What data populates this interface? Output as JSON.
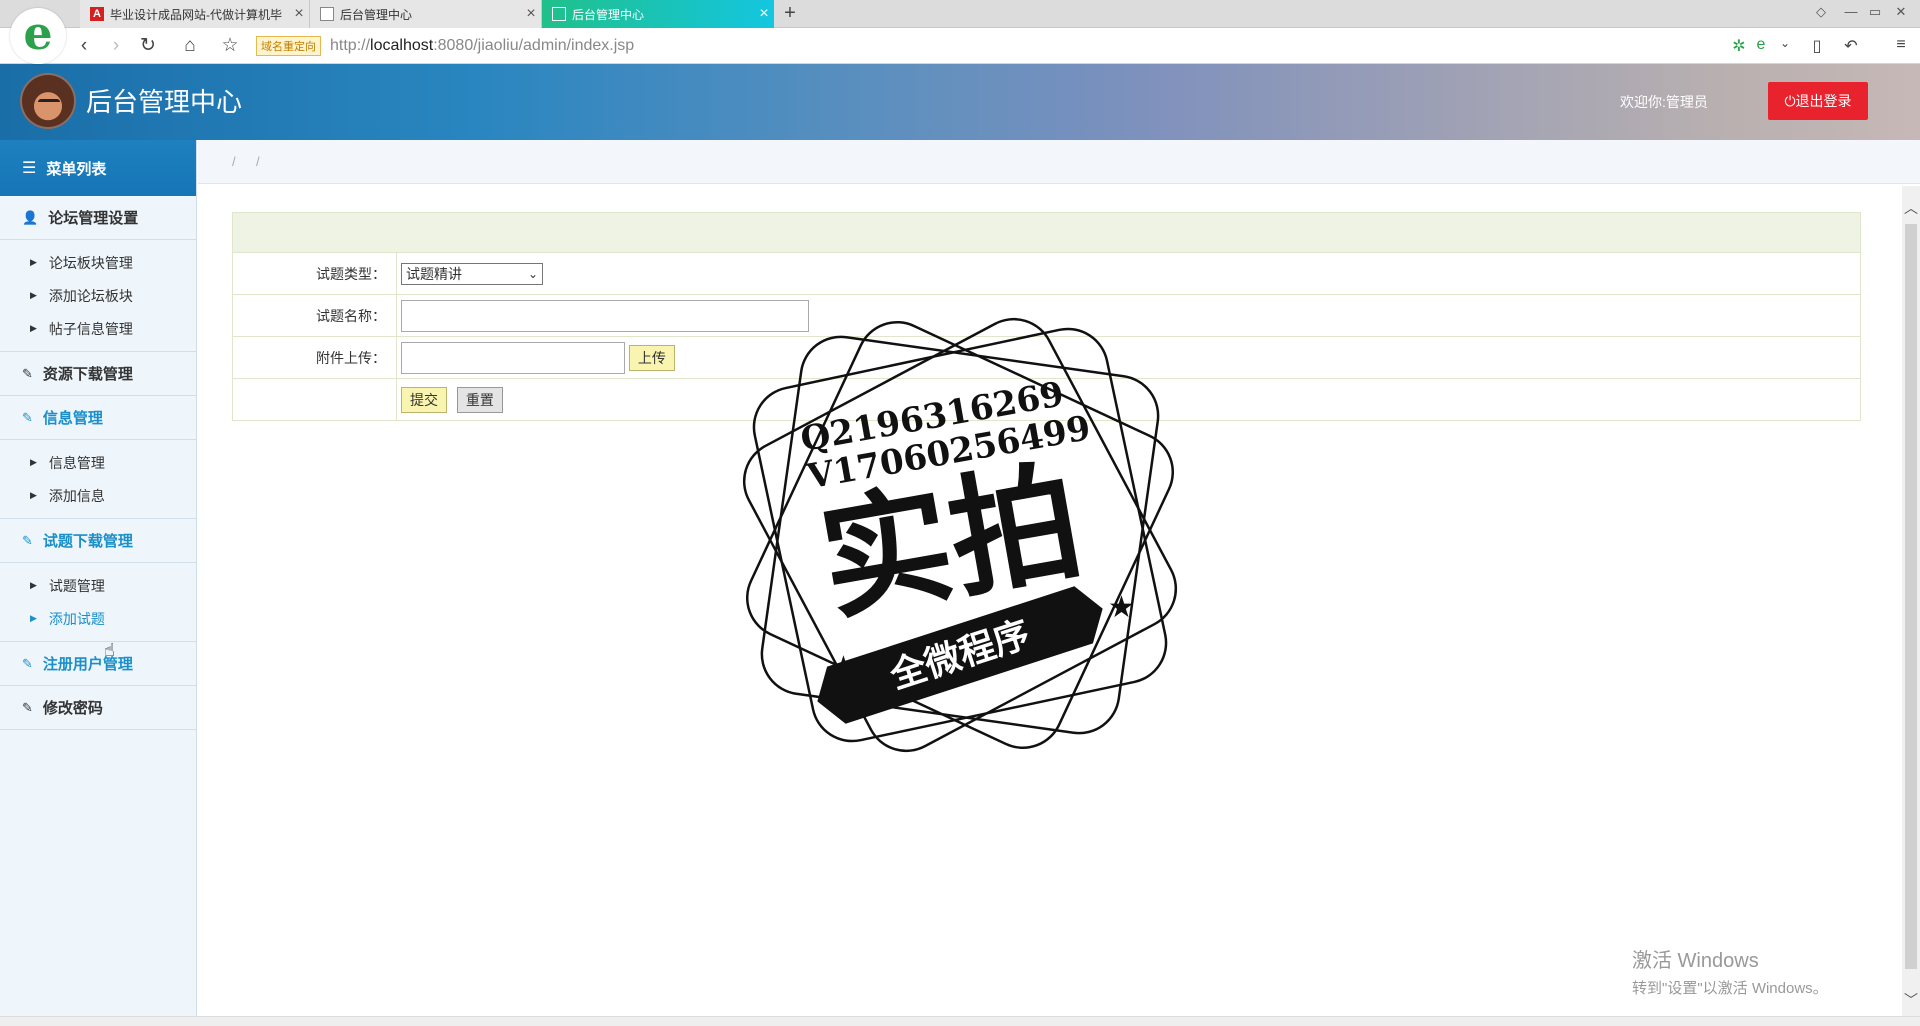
{
  "browser": {
    "logo": "e",
    "tabs": [
      {
        "title": "毕业设计成品网站-代做计算机毕",
        "icon": "A"
      },
      {
        "title": "后台管理中心",
        "icon": ""
      },
      {
        "title": "后台管理中心",
        "icon": ""
      }
    ],
    "redirect_badge": "域名重定向",
    "url_prefix": "http://",
    "url_host": "localhost",
    "url_rest": ":8080/jiaoliu/admin/index.jsp"
  },
  "header": {
    "title": "后台管理中心",
    "welcome": "欢迎你:管理员",
    "logout": "⏻退出登录"
  },
  "sidebar": {
    "menu_title": "菜单列表",
    "sections": [
      {
        "label": "论坛管理设置",
        "items": [
          "论坛板块管理",
          "添加论坛板块",
          "帖子信息管理"
        ]
      },
      {
        "label": "资源下载管理",
        "items": []
      },
      {
        "label": "信息管理",
        "items": [
          "信息管理",
          "添加信息"
        ]
      },
      {
        "label": "试题下载管理",
        "items": [
          "试题管理",
          "添加试题"
        ]
      },
      {
        "label": "注册用户管理",
        "items": []
      },
      {
        "label": "修改密码",
        "items": []
      }
    ]
  },
  "breadcrumb": [
    "/",
    "/"
  ],
  "form": {
    "type_label": "试题类型：",
    "type_value": "试题精讲",
    "name_label": "试题名称：",
    "name_value": "",
    "attach_label": "附件上传：",
    "upload_btn": "上传",
    "submit_btn": "提交",
    "reset_btn": "重置"
  },
  "watermark": {
    "line1": "Q2196316269",
    "line2": "V1706025649​9",
    "big": "实拍",
    "banner": "全微程序"
  },
  "windows": {
    "line1": "激活 Windows",
    "line2": "转到\"设置\"以激活 Windows。"
  }
}
